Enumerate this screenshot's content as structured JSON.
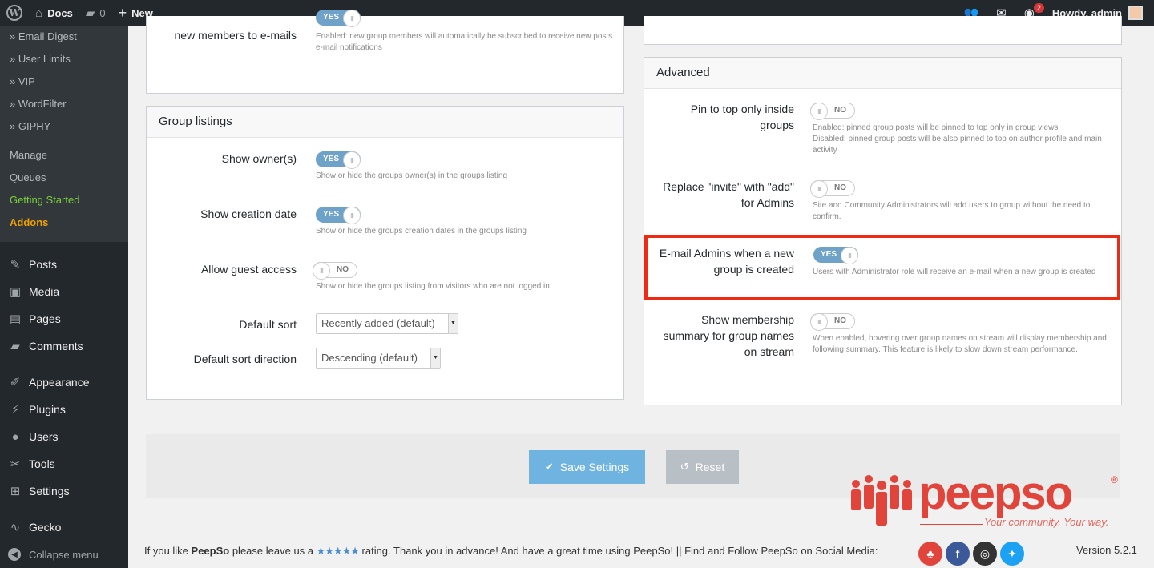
{
  "adminbar": {
    "site_name": "Docs",
    "comments_count": "0",
    "new_label": "New",
    "notif_count": "2",
    "howdy": "Howdy, admin"
  },
  "submenu": [
    {
      "label": "» Email Digest"
    },
    {
      "label": "» User Limits"
    },
    {
      "label": "» VIP"
    },
    {
      "label": "» WordFilter"
    },
    {
      "label": "» GIPHY"
    }
  ],
  "submenu2": {
    "manage": "Manage",
    "queues": "Queues",
    "getting_started": "Getting Started",
    "addons": "Addons"
  },
  "menu": [
    {
      "label": "Posts",
      "icon": "pin-icon"
    },
    {
      "label": "Media",
      "icon": "media-icon"
    },
    {
      "label": "Pages",
      "icon": "pages-icon"
    },
    {
      "label": "Comments",
      "icon": "comments-icon"
    },
    {
      "label": "Appearance",
      "icon": "brush-icon"
    },
    {
      "label": "Plugins",
      "icon": "plug-icon"
    },
    {
      "label": "Users",
      "icon": "users-icon"
    },
    {
      "label": "Tools",
      "icon": "wrench-icon"
    },
    {
      "label": "Settings",
      "icon": "settings-icon"
    },
    {
      "label": "Gecko",
      "icon": "gecko-icon"
    }
  ],
  "collapse_label": "Collapse menu",
  "top_left_panel": {
    "label": "new members to e-mails",
    "toggle": "YES",
    "desc": "Enabled: new group members will automatically be subscribed to receive new posts e-mail notifications"
  },
  "group_listings": {
    "title": "Group listings",
    "show_owner": {
      "label": "Show owner(s)",
      "toggle": "YES",
      "desc": "Show or hide the groups owner(s) in the groups listing"
    },
    "show_creation": {
      "label": "Show creation date",
      "toggle": "YES",
      "desc": "Show or hide the groups creation dates in the groups listing"
    },
    "guest_access": {
      "label": "Allow guest access",
      "toggle": "NO",
      "desc": "Show or hide the groups listing from visitors who are not logged in"
    },
    "default_sort": {
      "label": "Default sort",
      "value": "Recently added (default)"
    },
    "sort_direction": {
      "label": "Default sort direction",
      "value": "Descending (default)"
    }
  },
  "advanced": {
    "title": "Advanced",
    "pin_top": {
      "label_l1": "Pin to top only inside",
      "label_l2": "groups",
      "toggle": "NO",
      "desc_l1": "Enabled: pinned group posts will be pinned to top only in group views",
      "desc_l2": "Disabled: pinned group posts will be also pinned to top on author profile and main activity"
    },
    "replace_invite": {
      "label_l1": "Replace \"invite\" with \"add\"",
      "label_l2": "for Admins",
      "toggle": "NO",
      "desc": "Site and Community Administrators will add users to group without the need to confirm."
    },
    "email_admins": {
      "label_l1": "E-mail Admins when a new",
      "label_l2": "group is created",
      "toggle": "YES",
      "desc": "Users with Administrator role will receive an e-mail when a new group is created"
    },
    "membership_summary": {
      "label_l1": "Show membership",
      "label_l2": "summary for group names",
      "label_l3": "on stream",
      "toggle": "NO",
      "desc": "When enabled, hovering over group names on stream will display membership and following summary. This feature is likely to slow down stream performance."
    }
  },
  "buttons": {
    "save": "Save Settings",
    "reset": "Reset"
  },
  "logo": {
    "word": "peepso",
    "reg": "®",
    "tagline": "Your community. Your way."
  },
  "footer": {
    "part1": "If you like ",
    "brand": "PeepSo",
    "part2": " please leave us a ",
    "stars": "★★★★★",
    "part3": " rating. Thank you in advance! And have a great time using PeepSo! || Find and Follow PeepSo on Social Media:",
    "version": "Version 5.2.1"
  },
  "colors": {
    "accent": "#6fa2c8",
    "highlight": "#ee2a15",
    "brand": "#e0443a"
  }
}
